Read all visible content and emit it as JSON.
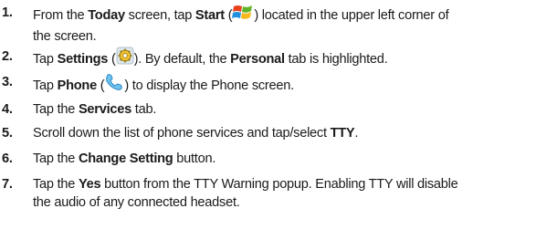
{
  "steps": [
    {
      "num": "1.",
      "a": "From the ",
      "b": "Today",
      "c": " screen, tap ",
      "d": "Start",
      "e": " (",
      "icon": "windows-start-icon",
      "f": ") located in the upper left corner of",
      "g": "the screen."
    },
    {
      "num": "2.",
      "a": "Tap ",
      "b": "Settings",
      "c": " (",
      "icon": "settings-gear-icon",
      "d": "). By default, the ",
      "e": "Personal",
      "f": " tab is highlighted."
    },
    {
      "num": "3.",
      "a": "Tap ",
      "b": "Phone",
      "c": " (",
      "icon": "phone-handset-icon",
      "d": ") to display the Phone screen."
    },
    {
      "num": "4.",
      "a": "Tap the ",
      "b": "Services",
      "c": " tab."
    },
    {
      "num": "5.",
      "a": "Scroll down the list of phone services and tap/select ",
      "b": "TTY",
      "c": "."
    },
    {
      "num": "6.",
      "a": "Tap the ",
      "b": "Change Setting",
      "c": " button."
    },
    {
      "num": "7.",
      "a": "Tap the ",
      "b": "Yes",
      "c": " button from the TTY Warning popup. Enabling TTY will disable",
      "d": "the audio of any connected headset."
    }
  ]
}
